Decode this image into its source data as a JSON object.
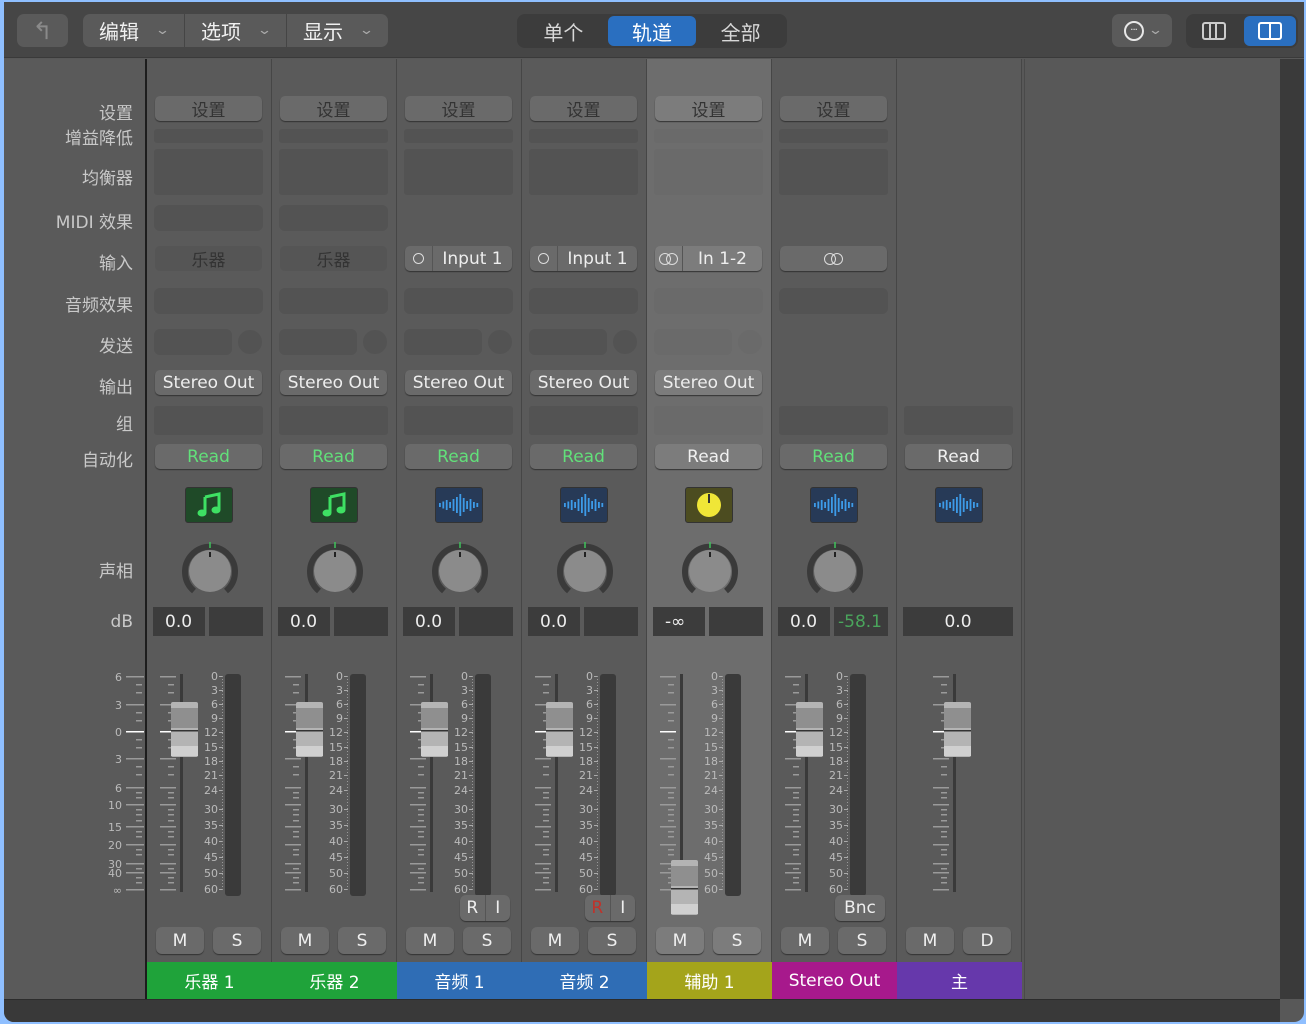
{
  "toolbar": {
    "back_icon": "↰",
    "menus": [
      "编辑",
      "选项",
      "显示"
    ],
    "view_segments": [
      {
        "label": "单个",
        "active": false
      },
      {
        "label": "轨道",
        "active": true
      },
      {
        "label": "全部",
        "active": false
      }
    ],
    "more_icon": "···",
    "layout_options": [
      "three-column",
      "two-column"
    ],
    "layout_active": "two-column",
    "accent": "#2a6fc0"
  },
  "row_labels": {
    "setting": "设置",
    "gain_reduction": "增益降低",
    "eq": "均衡器",
    "midi_fx": "MIDI 效果",
    "input": "输入",
    "audio_fx": "音频效果",
    "send": "发送",
    "output": "输出",
    "group": "组",
    "automation": "自动化",
    "pan": "声相",
    "db": "dB"
  },
  "fader_scale": {
    "left": [
      "6",
      "3",
      "0",
      "3",
      "6",
      "10",
      "15",
      "20",
      "30",
      "40",
      "∞"
    ],
    "meter": [
      "0",
      "3",
      "6",
      "9",
      "12",
      "15",
      "18",
      "21",
      "24",
      "30",
      "35",
      "40",
      "45",
      "50",
      "60"
    ]
  },
  "strips": [
    {
      "name": "乐器 1",
      "color": "#1fa33a",
      "setting": "设置",
      "input": "乐器",
      "input_type": "instrument",
      "output": "Stereo Out",
      "automation": "Read",
      "automation_green": true,
      "icon": "music-note",
      "volume": "0.0",
      "peak": "",
      "fader_db": 0,
      "buttons": [
        "M",
        "S"
      ],
      "extra": null
    },
    {
      "name": "乐器 2",
      "color": "#1fa33a",
      "setting": "设置",
      "input": "乐器",
      "input_type": "instrument",
      "output": "Stereo Out",
      "automation": "Read",
      "automation_green": true,
      "icon": "music-note",
      "volume": "0.0",
      "peak": "",
      "fader_db": 0,
      "buttons": [
        "M",
        "S"
      ],
      "extra": null
    },
    {
      "name": "音频 1",
      "color": "#2f6db5",
      "setting": "设置",
      "input": "Input 1",
      "input_type": "mono",
      "output": "Stereo Out",
      "automation": "Read",
      "automation_green": true,
      "icon": "waveform",
      "volume": "0.0",
      "peak": "",
      "fader_db": 0,
      "buttons": [
        "M",
        "S"
      ],
      "extra": {
        "type": "RI",
        "r": "R",
        "i": "I",
        "r_armed": false
      }
    },
    {
      "name": "音频 2",
      "color": "#2f6db5",
      "setting": "设置",
      "input": "Input 1",
      "input_type": "mono",
      "output": "Stereo Out",
      "automation": "Read",
      "automation_green": true,
      "icon": "waveform",
      "volume": "0.0",
      "peak": "",
      "fader_db": 0,
      "buttons": [
        "M",
        "S"
      ],
      "extra": {
        "type": "RI",
        "r": "R",
        "i": "I",
        "r_armed": true
      }
    },
    {
      "name": "辅助 1",
      "color": "#a4a41b",
      "setting": "设置",
      "input": "In 1-2",
      "input_type": "stereo",
      "output": "Stereo Out",
      "automation": "Read",
      "automation_green": false,
      "icon": "aux-knob",
      "volume": "-∞",
      "peak": "",
      "fader_db": "-inf",
      "buttons": [
        "M",
        "S"
      ],
      "selected": true,
      "extra": null
    },
    {
      "name": "Stereo Out",
      "color": "#a7198c",
      "setting": "设置",
      "input": "",
      "input_type": "stereo",
      "output": null,
      "automation": "Read",
      "automation_green": true,
      "icon": "waveform",
      "volume": "0.0",
      "peak": "-58.1",
      "fader_db": 0,
      "buttons": [
        "M",
        "S"
      ],
      "extra": {
        "type": "Bnc",
        "label": "Bnc"
      }
    },
    {
      "name": "主",
      "color": "#6638ab",
      "setting": null,
      "input": null,
      "input_type": null,
      "output": null,
      "automation": "Read",
      "automation_green": false,
      "icon": "waveform",
      "volume": "0.0",
      "peak": null,
      "fader_db": 0,
      "buttons": [
        "M",
        "D"
      ],
      "extra": null,
      "master": true
    }
  ]
}
